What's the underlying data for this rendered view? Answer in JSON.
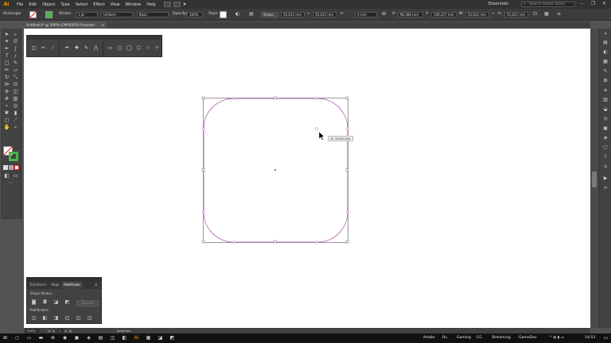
{
  "app": {
    "logo": "Ai",
    "title": "Untitled-1* @ 300% (CMYK/GPU Preview)"
  },
  "menu": [
    "File",
    "Edit",
    "Object",
    "Type",
    "Select",
    "Effect",
    "View",
    "Window",
    "Help"
  ],
  "workspace": "Essentials",
  "help_search_placeholder": "Search Adobe Stock",
  "window_controls": [
    "–",
    "❐",
    "✕"
  ],
  "controlbar": {
    "selection_label": "Rectangle",
    "stroke_label": "Stroke:",
    "stroke_value": "1 pt",
    "profile_value": "Uniform",
    "brush_value": "Basic",
    "opacity_label": "Opacity:",
    "opacity_value": "100%",
    "style_label": "Style:",
    "shape_button": "Shape:",
    "width_value": "55,622 mm",
    "height_value": "55,622 mm",
    "corner_value": "0 mm",
    "x_label": "X:",
    "x_value": "96,386 mm",
    "y_label": "Y:",
    "y_value": "146,227 mm",
    "w_label": "W:",
    "w_value": "55,622 mm",
    "h_label": "H:",
    "h_value": "55,622 mm"
  },
  "tooltip": "R: 15,09 mm",
  "pathfinder": {
    "tabs": [
      "Transform",
      "Align",
      "Pathfinder"
    ],
    "active_tab": "Pathfinder",
    "shape_modes_label": "Shape Modes:",
    "pathfinders_label": "Pathfinders:",
    "expand_label": "Expand"
  },
  "statusbar": {
    "zoom": "300%",
    "page": "1",
    "tool": "Selection"
  },
  "taskbar": {
    "labels": [
      "Adobe",
      "Ru",
      "Gaming",
      "CG",
      "Streaming",
      "GameDev"
    ],
    "time": "14:53"
  },
  "colors": {
    "accent": "#ff9a00",
    "path": "#b36bb5",
    "bounding": "#7d7d7d",
    "fill_swatch": "#4cb34a"
  },
  "icons": {
    "toolbar": [
      "selection-icon",
      "direct-selection-icon",
      "magic-wand-icon",
      "lasso-icon",
      "pen-icon",
      "curvature-icon",
      "type-icon",
      "line-icon",
      "rectangle-icon",
      "paintbrush-icon",
      "pencil-icon",
      "eraser-icon",
      "rotate-icon",
      "scale-icon",
      "width-icon",
      "free-transform-icon",
      "shape-builder-icon",
      "perspective-icon",
      "mesh-icon",
      "gradient-icon",
      "eyedropper-icon",
      "blend-icon",
      "symbol-sprayer-icon",
      "graph-icon",
      "artboard-icon",
      "slice-icon",
      "hand-icon",
      "zoom-icon"
    ]
  }
}
